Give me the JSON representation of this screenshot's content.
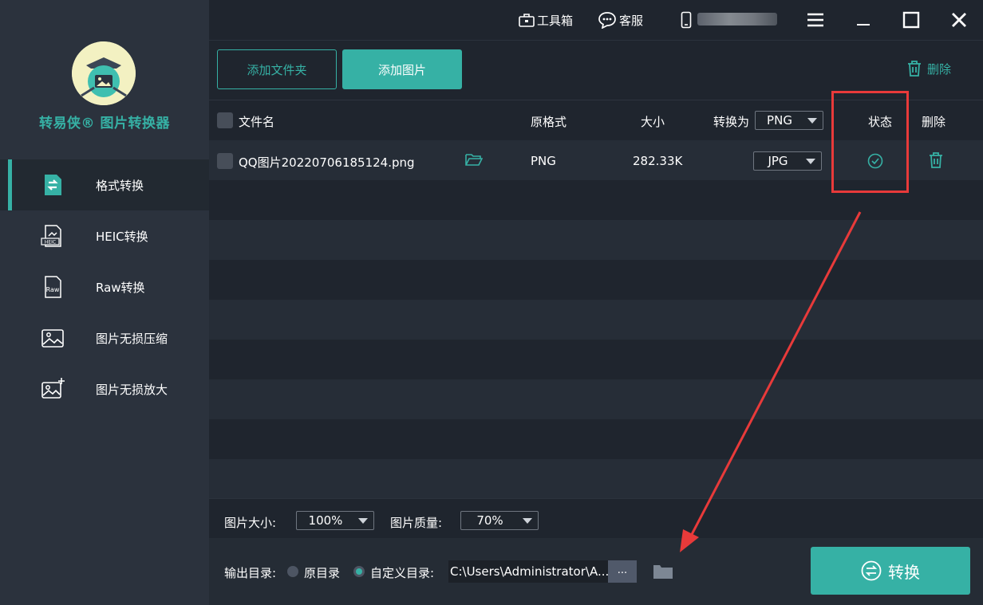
{
  "app": {
    "name": "转易侠® 图片转换器",
    "accent_color": "#36b1a5"
  },
  "sidebar": {
    "items": [
      {
        "label": "格式转换",
        "icon": "format-convert-icon",
        "active": true
      },
      {
        "label": "HEIC转换",
        "icon": "heic-file-icon",
        "active": false
      },
      {
        "label": "Raw转换",
        "icon": "raw-file-icon",
        "active": false
      },
      {
        "label": "图片无损压缩",
        "icon": "image-compress-icon",
        "active": false
      },
      {
        "label": "图片无损放大",
        "icon": "image-enlarge-icon",
        "active": false
      }
    ]
  },
  "titlebar": {
    "toolbox_label": "工具箱",
    "service_label": "客服"
  },
  "toolbar": {
    "add_folder_label": "添加文件夹",
    "add_image_label": "添加图片",
    "delete_label": "删除"
  },
  "table": {
    "headers": {
      "filename": "文件名",
      "original_format": "原格式",
      "size": "大小",
      "convert_to": "转换为",
      "status": "状态",
      "delete": "删除"
    },
    "global_target_format": "PNG",
    "rows": [
      {
        "filename": "QQ图片20220706185124.png",
        "original_format": "PNG",
        "size": "282.33K",
        "target_format": "JPG",
        "status": "done"
      }
    ]
  },
  "settings": {
    "image_size_label": "图片大小:",
    "image_size_value": "100%",
    "image_quality_label": "图片质量:",
    "image_quality_value": "70%"
  },
  "output": {
    "label": "输出目录:",
    "option_original": "原目录",
    "option_custom": "自定义目录:",
    "selected": "custom",
    "path": "C:\\Users\\Administrator\\A...",
    "browse_label": "..."
  },
  "convert_button_label": "转换"
}
